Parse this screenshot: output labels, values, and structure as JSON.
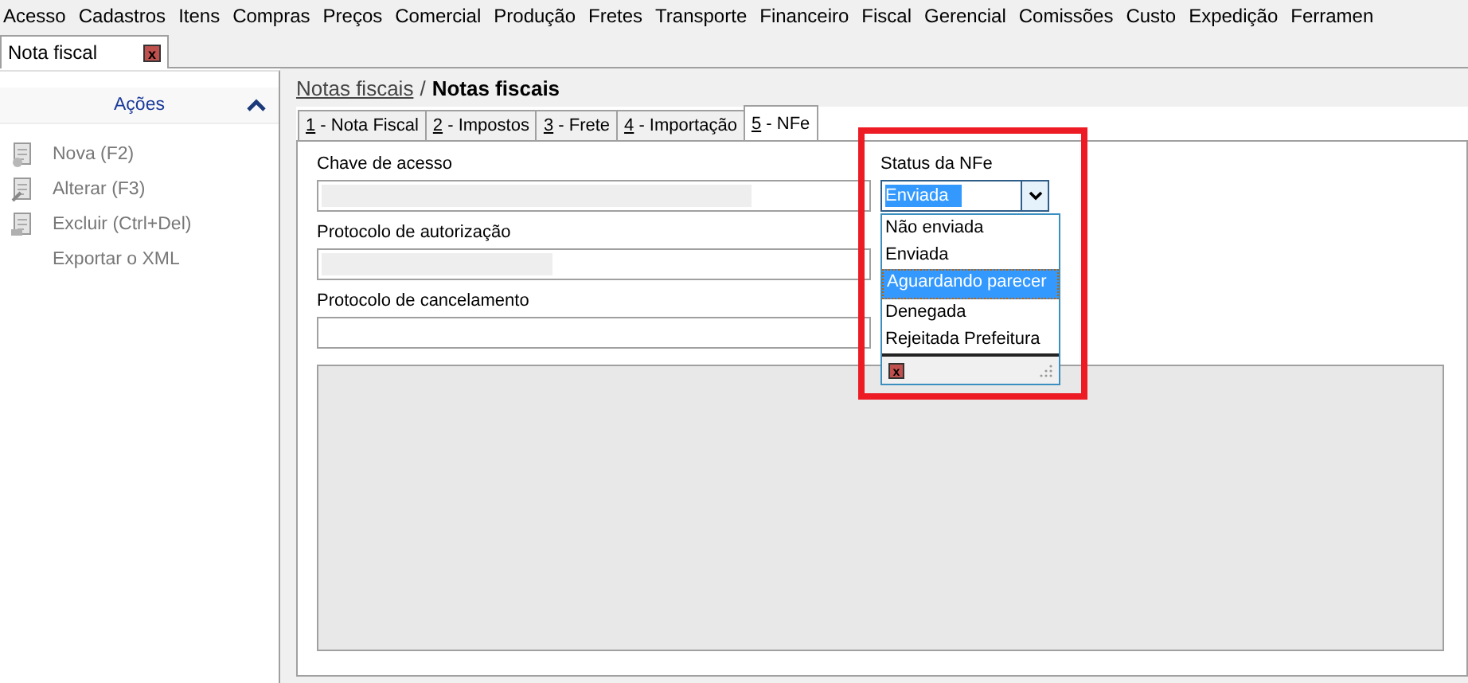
{
  "menu": [
    "Acesso",
    "Cadastros",
    "Itens",
    "Compras",
    "Preços",
    "Comercial",
    "Produção",
    "Fretes",
    "Transporte",
    "Financeiro",
    "Fiscal",
    "Gerencial",
    "Comissões",
    "Custo",
    "Expedição",
    "Ferramen"
  ],
  "doc_tab": {
    "label": "Nota fiscal",
    "close_glyph": "x"
  },
  "sidebar": {
    "title": "Ações",
    "expanded": true,
    "items": [
      {
        "label": "Nova (F2)",
        "kind": "add"
      },
      {
        "label": "Alterar (F3)",
        "kind": "edit"
      },
      {
        "label": "Excluir (Ctrl+Del)",
        "kind": "delete"
      },
      {
        "label": "Exportar o XML",
        "kind": "plain"
      }
    ]
  },
  "breadcrumb": {
    "link": "Notas fiscais",
    "separator": "/",
    "current": "Notas fiscais"
  },
  "tabs": [
    {
      "key": "1",
      "label": " - Nota Fiscal",
      "selected": false
    },
    {
      "key": "2",
      "label": " - Impostos",
      "selected": false
    },
    {
      "key": "3",
      "label": " - Frete",
      "selected": false
    },
    {
      "key": "4",
      "label": " - Importação",
      "selected": false
    },
    {
      "key": "5",
      "label": " - NFe",
      "selected": true
    }
  ],
  "fields": [
    {
      "label": "Chave de acesso"
    },
    {
      "label": "Protocolo de autorização"
    },
    {
      "label": "Protocolo de cancelamento"
    }
  ],
  "status": {
    "label": "Status da NFe",
    "value": "Enviada",
    "close_glyph": "x",
    "options": [
      {
        "label": "Não enviada",
        "highlighted": false
      },
      {
        "label": "Enviada",
        "highlighted": false
      },
      {
        "label": "Aguardando parecer",
        "highlighted": true
      },
      {
        "label": "Denegada",
        "highlighted": false
      },
      {
        "label": "Rejeitada Prefeitura",
        "highlighted": false
      }
    ]
  }
}
